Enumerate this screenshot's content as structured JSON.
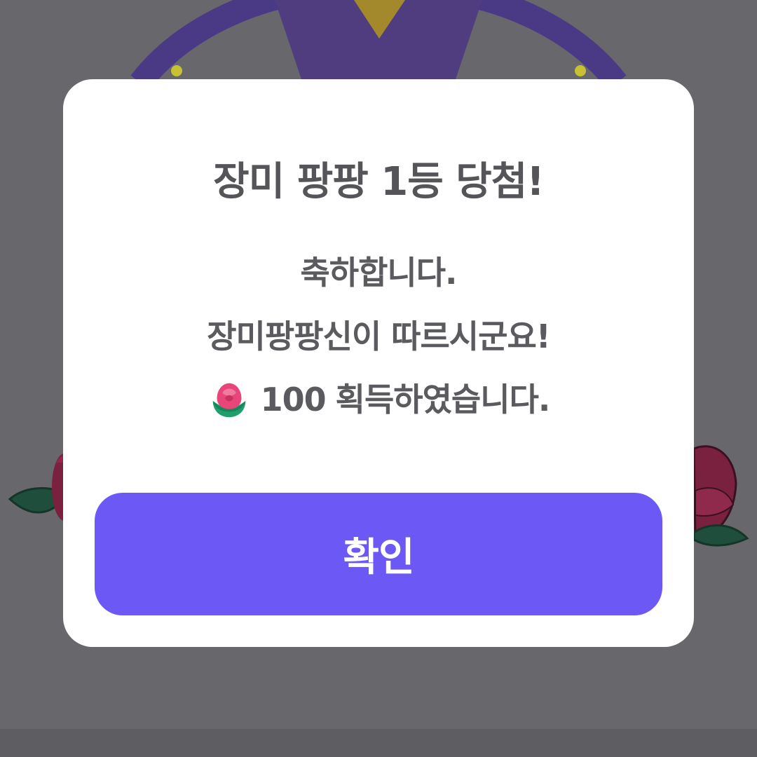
{
  "dialog": {
    "title": "장미 팡팡 1등 당첨!",
    "message_line_1": "축하합니다.",
    "message_line_2": "장미팡팡신이 따르시군요!",
    "reward_amount": "100",
    "reward_suffix": "획득하였습니다.",
    "reward_icon": "rose-icon",
    "confirm_label": "확인"
  },
  "colors": {
    "overlay": "#68676b",
    "modal_background": "#ffffff",
    "text": "#555459",
    "confirm_button": "#6c59f5",
    "confirm_text": "#ffffff"
  }
}
